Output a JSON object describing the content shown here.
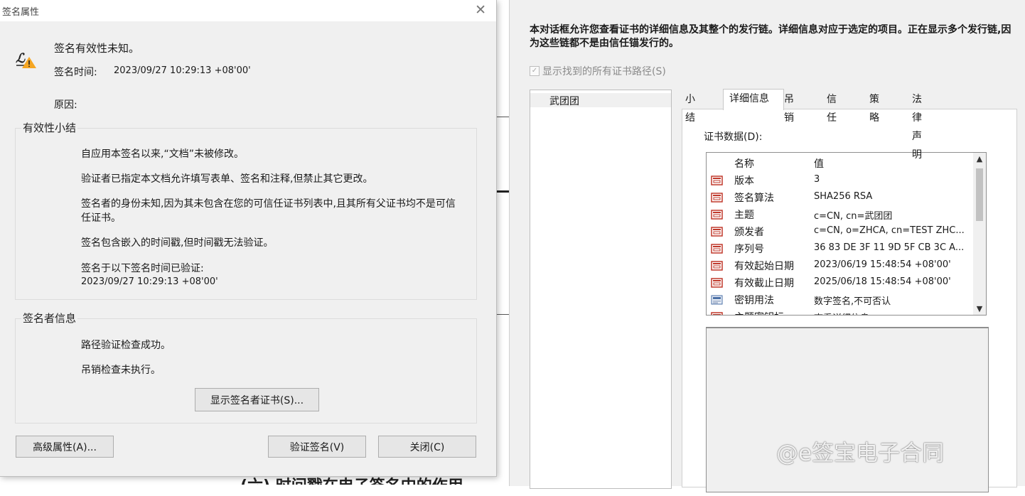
{
  "background": {
    "article_text": "(六) 时间戳在电子签名中的作用"
  },
  "left_dialog": {
    "title": "签名属性",
    "status": "签名有效性未知。",
    "sign_time_label": "签名时间:",
    "sign_time_value": "2023/09/27 10:29:13 +08'00'",
    "reason_label": "原因:",
    "validity_summary": {
      "title": "有效性小结",
      "items": [
        "自应用本签名以来,“文档”未被修改。",
        "验证者已指定本文档允许填写表单、签名和注释,但禁止其它更改。",
        "签名者的身份未知,因为其未包含在您的可信任证书列表中,且其所有父证书均不是可信任证书。",
        "签名包含嵌入的时间戳,但时间戳无法验证。",
        "签名于以下签名时间已验证:"
      ],
      "verified_time": "2023/09/27 10:29:13 +08'00'"
    },
    "signer_info": {
      "title": "签名者信息",
      "items": [
        "路径验证检查成功。",
        "吊销检查未执行。"
      ],
      "show_cert_button": "显示签名者证书(S)..."
    },
    "buttons": {
      "advanced": "高级属性(A)...",
      "verify": "验证签名(V)",
      "close": "关闭(C)"
    }
  },
  "right_dialog": {
    "description": "本对话框允许您查看证书的详细信息及其整个的发行链。详细信息对应于选定的项目。正在显示多个发行链,因为这些链都不是由信任锚发行的。",
    "show_all_paths": {
      "label": "显示找到的所有证书路径(S)",
      "checked": true
    },
    "tree": {
      "items": [
        "武团团"
      ]
    },
    "tabs": [
      "小结",
      "详细信息",
      "吊销",
      "信任",
      "策略",
      "法律声明"
    ],
    "active_tab": "详细信息",
    "cert_data_label": "证书数据(D):",
    "columns": {
      "name": "名称",
      "value": "值"
    },
    "rows": [
      {
        "name": "版本",
        "value": "3",
        "icon": "cert-field-icon"
      },
      {
        "name": "签名算法",
        "value": "SHA256 RSA",
        "icon": "cert-field-icon"
      },
      {
        "name": "主题",
        "value": "c=CN, cn=武团团",
        "icon": "cert-field-icon"
      },
      {
        "name": "颁发者",
        "value": "c=CN, o=ZHCA, cn=TEST ZHC...",
        "icon": "cert-field-icon"
      },
      {
        "name": "序列号",
        "value": "36 83 DE 3F 11 9D 5F CB 3C A...",
        "icon": "cert-field-icon"
      },
      {
        "name": "有效起始日期",
        "value": "2023/06/19 15:48:54 +08'00'",
        "icon": "cert-field-icon"
      },
      {
        "name": "有效截止日期",
        "value": "2025/06/18 15:48:54 +08'00'",
        "icon": "cert-field-icon"
      },
      {
        "name": "密钥用法",
        "value": "数字签名,不可否认",
        "icon": "key-usage-icon"
      },
      {
        "name": "主题密钥标",
        "value": "查看详细信息",
        "icon": "cert-field-icon"
      }
    ]
  },
  "watermark": "@e签宝电子合同",
  "colors": {
    "dialog_bg": "#f0f0f0",
    "warning": "#f5a623",
    "icon_red": "#c0392b"
  }
}
